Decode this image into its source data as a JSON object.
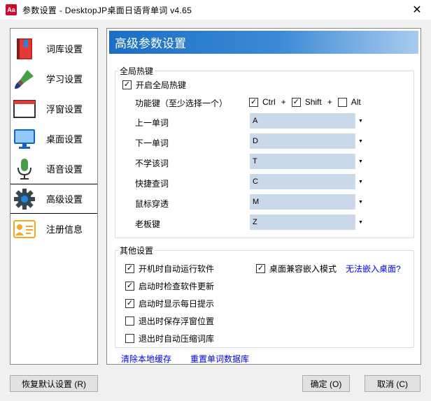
{
  "window": {
    "title": "参数设置 - DesktopJP桌面日语背单词 v4.65",
    "app_icon_text": "Aa",
    "close_glyph": "✕"
  },
  "sidebar": {
    "items": [
      {
        "label": "词库设置",
        "icon": "book-icon"
      },
      {
        "label": "学习设置",
        "icon": "brush-icon"
      },
      {
        "label": "浮窗设置",
        "icon": "window-icon"
      },
      {
        "label": "桌面设置",
        "icon": "monitor-icon"
      },
      {
        "label": "语音设置",
        "icon": "microphone-icon"
      },
      {
        "label": "高级设置",
        "icon": "gear-icon",
        "selected": true
      },
      {
        "label": "注册信息",
        "icon": "id-card-icon"
      }
    ]
  },
  "main": {
    "header": "高级参数设置",
    "hotkeys": {
      "legend": "全局热键",
      "enable_label": "开启全局热键",
      "enable_checked": true,
      "modifier_label": "功能键（至少选择一个）",
      "ctrl_label": "Ctrl",
      "ctrl_checked": true,
      "shift_label": "Shift",
      "shift_checked": true,
      "alt_label": "Alt",
      "alt_checked": false,
      "plus": "+",
      "rows": [
        {
          "label": "上一单词",
          "value": "A"
        },
        {
          "label": "下一单词",
          "value": "D"
        },
        {
          "label": "不学该词",
          "value": "T"
        },
        {
          "label": "快捷查词",
          "value": "C"
        },
        {
          "label": "鼠标穿透",
          "value": "M"
        },
        {
          "label": "老板键",
          "value": "Z"
        }
      ]
    },
    "other": {
      "legend": "其他设置",
      "options": [
        {
          "label": "开机时自动运行软件",
          "checked": true
        },
        {
          "label": "启动时检查软件更新",
          "checked": true
        },
        {
          "label": "启动时显示每日提示",
          "checked": true
        },
        {
          "label": "退出时保存浮窗位置",
          "checked": false
        },
        {
          "label": "退出时自动压缩词库",
          "checked": false
        }
      ],
      "embed_label": "桌面兼容嵌入模式",
      "embed_checked": true,
      "embed_link": "无法嵌入桌面?"
    },
    "links": {
      "clear_cache": "清除本地缓存",
      "reset_db": "重置单词数据库"
    }
  },
  "buttons": {
    "restore": "恢复默认设置 (R)",
    "ok": "确定 (O)",
    "cancel": "取消 (C)"
  },
  "colors": {
    "header_gradient_start": "#1a6fc4",
    "header_gradient_end": "#a9cbed",
    "select_bg": "#c9d9ea",
    "link": "#0000ee"
  }
}
